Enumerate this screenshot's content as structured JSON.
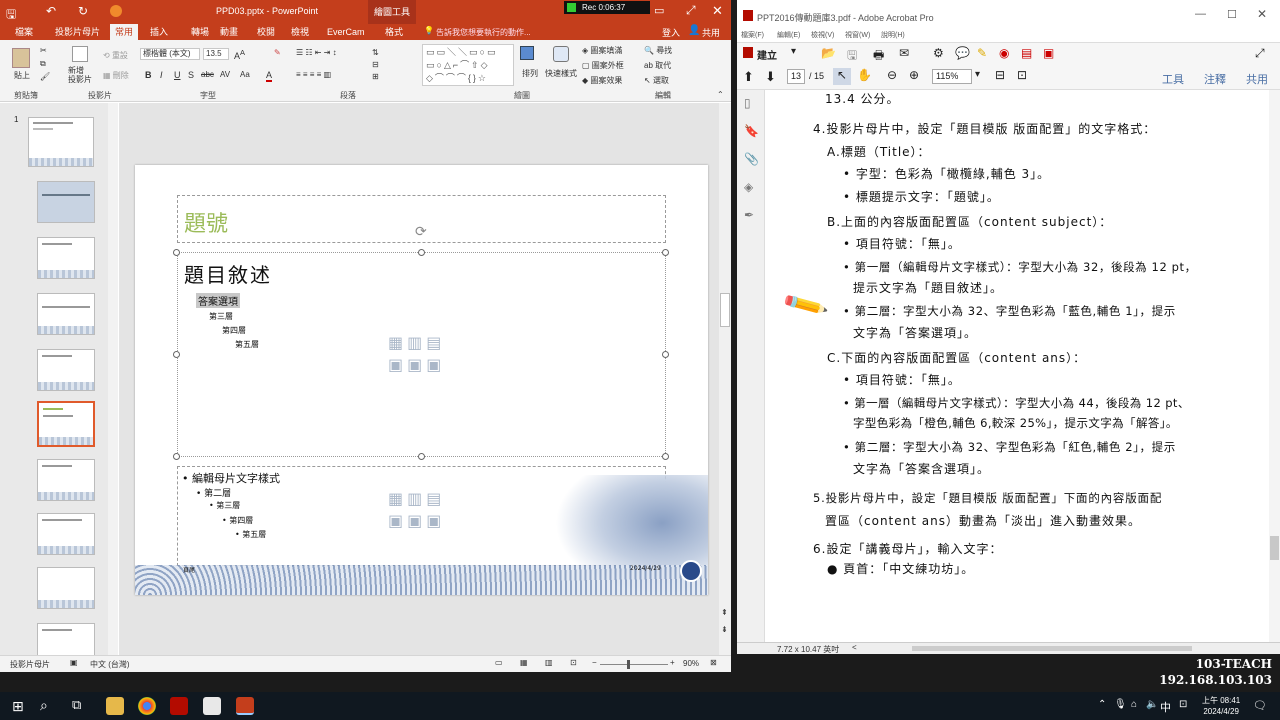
{
  "ppt": {
    "title": "PPD03.pptx - PowerPoint",
    "context_tab": "繪圖工具",
    "rec": "Rec 0:06:37",
    "tabs": [
      "檔案",
      "投影片母片",
      "常用",
      "插入",
      "動畫",
      "轉場",
      "校閱",
      "檢視",
      "EverCam",
      "格式"
    ],
    "tell_me": "告訴我您想要執行的動作...",
    "sign_in": "登入",
    "share": "共用",
    "ribbon": {
      "paste": "貼上",
      "new_slide": "新增\n投影片",
      "reset": "重設",
      "delete": "刪除",
      "font_name": "標楷體 (本文)",
      "font_size": "13.5",
      "arrange": "排列",
      "quick_styles": "快速樣式",
      "shape_fill": "圖案填滿",
      "shape_outline": "圖案外框",
      "shape_effects": "圖案效果",
      "find": "尋找",
      "replace": "取代",
      "select": "選取",
      "groups": [
        "剪貼簿",
        "投影片",
        "字型",
        "段落",
        "繪圖",
        "編輯"
      ]
    },
    "slide": {
      "title": "題號",
      "subject": "題目敘述",
      "level2": "答案選項",
      "level3": "第三層",
      "level4": "第四層",
      "level5": "第五層",
      "ans_l1": "• 編輯母片文字樣式",
      "ans_l2": "• 第二層",
      "ans_l3": "• 第三層",
      "ans_l4": "• 第四層",
      "ans_l5": "• 第五層",
      "footer_left": "頁尾",
      "footer_date": "2024/4/29"
    },
    "status": {
      "left": "投影片母片",
      "lang": "中文 (台灣)",
      "zoom": "90%"
    }
  },
  "acro": {
    "title": "PPT2016傳動題庫3.pdf - Adobe Acrobat Pro",
    "menu": [
      "檔案(F)",
      "編輯(E)",
      "檢視(V)",
      "視窗(W)",
      "說明(H)"
    ],
    "create": "建立",
    "page_num": "13",
    "page_total": "/ 15",
    "zoom": "115%",
    "tools": "工具",
    "comment": "注釋",
    "share": "共用",
    "size": "7.72 x 10.47 英吋",
    "lines": [
      "13.4 公分。",
      "4.投影片母片中，設定「題目模版 版面配置」的文字格式：",
      "A.標題（Title）：",
      "• 字型：色彩為「橄欖綠,輔色 3」。",
      "• 標題提示文字：「題號」。",
      "B.上面的內容版面配置區（content subject）：",
      "• 項目符號：「無」。",
      "• 第一層（編輯母片文字樣式）：字型大小為 32，後段為 12 pt，",
      "提示文字為「題目敘述」。",
      "• 第二層：字型大小為 32、字型色彩為「藍色,輔色 1」，提示",
      "文字為「答案選項」。",
      "C.下面的內容版面配置區（content ans）：",
      "• 項目符號：「無」。",
      "• 第一層（編輯母片文字樣式）：字型大小為 44，後段為 12 pt、",
      "字型色彩為「橙色,輔色 6,較深 25%」，提示文字為「解答」。",
      "• 第二層：字型大小為 32、字型色彩為「紅色,輔色 2」，提示",
      "文字為「答案含選項」。",
      "5.投影片母片中，設定「題目模版 版面配置」下面的內容版面配",
      "置區（content ans）動畫為「淡出」進入動畫效果。",
      "6.設定「講義母片」，輸入文字：",
      "● 頁首：「中文練功坊」。"
    ]
  },
  "taskbar": {
    "time": "上午 08:41",
    "date": "2024/4/29",
    "ime": "中",
    "watermark_line1": "103-TEACH",
    "watermark_line2": "192.168.103.103"
  },
  "colors": {
    "ppt_accent": "#c43e1c",
    "title_green": "#9bbb59",
    "acro_red": "#b30b00"
  }
}
